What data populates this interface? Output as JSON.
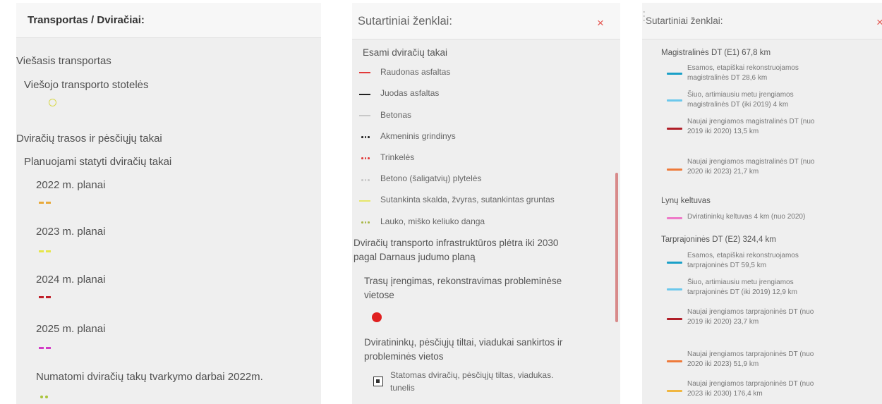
{
  "panel1": {
    "title": "Transportas / Dviračiai:",
    "items": [
      {
        "label": "Viešasis transportas"
      },
      {
        "label": "Viešojo transporto stotelės"
      },
      {
        "label": "Dviračių trasos ir pėsčiųjų takai"
      },
      {
        "label": "Planuojami statyti dviračių takai"
      },
      {
        "label": "2022 m. planai",
        "color": "#e8a93a"
      },
      {
        "label": "2023 m. planai",
        "color": "#e6e64a"
      },
      {
        "label": "2024 m. planai",
        "color": "#c0202a"
      },
      {
        "label": "2025 m. planai",
        "color": "#d23cc6"
      },
      {
        "label": "Numatomi dviračių takų tvarkymo darbai 2022m.",
        "color": "#a9c43a"
      }
    ],
    "stop_color": "#d8d84a"
  },
  "panel2": {
    "title": "Sutartiniai ženklai:",
    "close_icon": "×",
    "group1": "Esami dviračių takai",
    "legend": [
      {
        "label": "Raudonas asfaltas",
        "style": "line",
        "color": "#e23a3a"
      },
      {
        "label": "Juodas asfaltas",
        "style": "line",
        "color": "#222222"
      },
      {
        "label": "Betonas",
        "style": "line",
        "color": "#c8c8c8"
      },
      {
        "label": "Akmeninis grindinys",
        "style": "dots",
        "color": "#222222"
      },
      {
        "label": "Trinkelės",
        "style": "dots",
        "color": "#e23a3a"
      },
      {
        "label": "Betono (šaligatvių) plytelės",
        "style": "dots",
        "color": "#c8c8c8"
      },
      {
        "label": "Sutankinta skalda, žvyras, sutankintas gruntas",
        "style": "line",
        "color": "#e6e66a"
      },
      {
        "label": "Lauko, miško keliuko danga",
        "style": "dots",
        "color": "#a9b84a"
      }
    ],
    "group2_line1": "Dviračių transporto infrastruktūros plėtra iki 2030",
    "group2_line2": "pagal Darnaus judumo planą",
    "group3_line1": "Trasų įrengimas, rekonstravimas probleminėse",
    "group3_line2": "vietose",
    "group4_line1": "Dviratininkų, pėsčiųjų tiltai, viadukai sankirtos ir",
    "group4_line2": "probleminės vietos",
    "bridge_line1": "Statomas dviračių, pėsčiųjų tiltas, viadukas.",
    "bridge_line2": "tunelis"
  },
  "panel3": {
    "title": "Sutartiniai ženklai:",
    "close_icon": "×",
    "groups": [
      {
        "heading": "Magistralinės DT (E1) 67,8 km"
      },
      {
        "heading": "Lynų keltuvas"
      },
      {
        "heading": "Tarprajoninės DT (E2) 324,4 km"
      }
    ],
    "items": [
      {
        "line1": "Esamos, etapiškai rekonstruojamos",
        "line2": "magistralinės DT 28,6 km",
        "color": "#1aa0c8"
      },
      {
        "line1": "Šiuo, artimiausiu metu įrengiamos",
        "line2": "magistralinės DT (iki 2019) 4 km",
        "color": "#6cc8ec"
      },
      {
        "line1": "Naujai įrengiamos magistralinės DT (nuo",
        "line2": "2019 iki 2020) 13,5 km",
        "color": "#b01e28"
      },
      {
        "line1": "Naujai įrengiamos magistralinės DT (nuo",
        "line2": "2020 iki 2023) 21,7 km",
        "color": "#ee7a3a"
      },
      {
        "line1": "Dviratininkų keltuvas 4 km (nuo 2020)",
        "line2": "",
        "color": "#ee7ac8"
      },
      {
        "line1": "Esamos, etapiškai rekonstruojamos",
        "line2": "tarprajoninės DT 59,5 km",
        "color": "#1aa0c8"
      },
      {
        "line1": "Šiuo, artimiausiu metu įrengiamos",
        "line2": "tarprajoninės DT (iki 2019) 12,9 km",
        "color": "#6cc8ec"
      },
      {
        "line1": "Naujai įrengiamos tarprajoninės DT (nuo",
        "line2": "2019 iki 2020) 23,7 km",
        "color": "#b01e28"
      },
      {
        "line1": "Naujai įrengiamos tarprajoninės DT (nuo",
        "line2": "2020 iki 2023) 51,9 km",
        "color": "#ee7a3a"
      },
      {
        "line1": "Naujai įrengiamos tarprajoninės DT (nuo",
        "line2": "2023 iki 2030) 176,4 km",
        "color": "#f0b640"
      }
    ]
  }
}
